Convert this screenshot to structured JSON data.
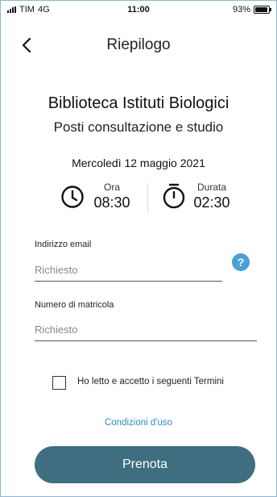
{
  "status_bar": {
    "carrier": "TIM",
    "network": "4G",
    "time": "11:00",
    "battery": "93%",
    "battery_level": 0.93
  },
  "header": {
    "title": "Riepilogo",
    "back_icon": "chevron-left-icon"
  },
  "booking": {
    "venue": "Biblioteca Istituti Biologici",
    "service": "Posti consultazione e studio",
    "date": "Mercoledì 12 maggio 2021",
    "time_label": "Ora",
    "time_value": "08:30",
    "duration_label": "Durata",
    "duration_value": "02:30"
  },
  "form": {
    "email_label": "Indirizzo email",
    "email_placeholder": "Richiesto",
    "student_id_label": "Numero di matricola",
    "student_id_placeholder": "Richiesto",
    "help_symbol": "?",
    "terms_text": "Ho letto e accetto i seguenti Termini",
    "terms_checked": false,
    "conditions_link": "Condizioni d'uso",
    "submit_label": "Prenota"
  },
  "colors": {
    "accent": "#4a9fd6",
    "button": "#3e6e80",
    "link": "#2b8fc0"
  }
}
